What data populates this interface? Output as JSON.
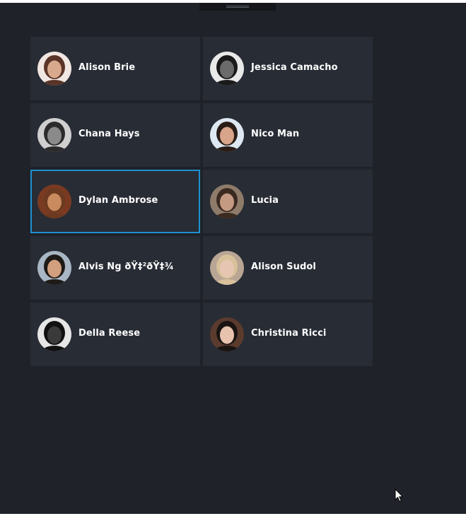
{
  "contacts": [
    {
      "name": "Alison Brie",
      "avatar": "avatar-photo",
      "bg": "#f1e7e2",
      "skin": "#d9a98e",
      "hair": "#5a3527",
      "selected": false
    },
    {
      "name": "Jessica Camacho",
      "avatar": "avatar-photo",
      "bg": "#e9e9e9",
      "skin": "#6b6b6b",
      "hair": "#1a1a1a",
      "selected": false
    },
    {
      "name": "Chana Hays",
      "avatar": "avatar-photo",
      "bg": "#cfcfcf",
      "skin": "#8a8a8a",
      "hair": "#2b2b2b",
      "selected": false
    },
    {
      "name": "Nico Man",
      "avatar": "avatar-photo",
      "bg": "#dde8f2",
      "skin": "#d8a58a",
      "hair": "#2a1d18",
      "selected": false
    },
    {
      "name": "Dylan Ambrose",
      "avatar": "avatar-photo",
      "bg": "#7a3a22",
      "skin": "#c98b5e",
      "hair": "#6b3a20",
      "selected": true
    },
    {
      "name": "Lucia",
      "avatar": "avatar-photo",
      "bg": "#8e7b6a",
      "skin": "#c49a82",
      "hair": "#3b2a20",
      "selected": false
    },
    {
      "name": "Alvis Ng ðŸ‡²ðŸ‡¾",
      "avatar": "avatar-photo",
      "bg": "#a9b6c4",
      "skin": "#d2a07e",
      "hair": "#1e1a17",
      "selected": false
    },
    {
      "name": "Alison Sudol",
      "avatar": "avatar-photo",
      "bg": "#b9a594",
      "skin": "#e6c6b2",
      "hair": "#d8c19a",
      "selected": false
    },
    {
      "name": "Della Reese",
      "avatar": "avatar-photo",
      "bg": "#e6e6e6",
      "skin": "#3a3a3a",
      "hair": "#111111",
      "selected": false
    },
    {
      "name": "Christina Ricci",
      "avatar": "avatar-photo",
      "bg": "#5a3b2e",
      "skin": "#e7c2ad",
      "hair": "#1a1412",
      "selected": false
    }
  ],
  "colors": {
    "background": "#1f2228",
    "tile": "#282c35",
    "selection_border": "#1e90d2",
    "text": "#ffffff"
  },
  "icons": {
    "drag_handle": "grip-icon",
    "cursor": "mouse-pointer-icon"
  }
}
